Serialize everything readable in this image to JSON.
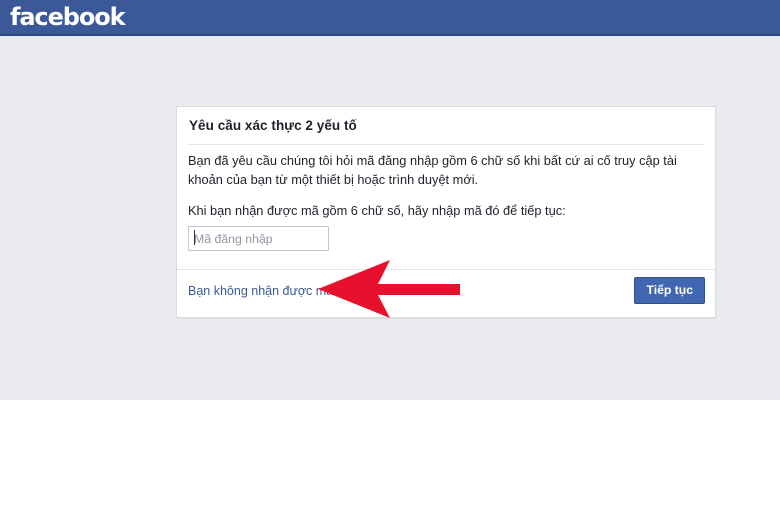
{
  "topbar": {
    "logo_text": "facebook",
    "background_color": "#3b5998"
  },
  "card": {
    "title": "Yêu cầu xác thực 2 yếu tố",
    "paragraphs": [
      "Bạn đã yêu cầu chúng tôi hỏi mã đăng nhập gồm 6 chữ số khi bất cứ ai cố truy cập tài khoản của bạn từ một thiết bị hoặc trình duyệt mới.",
      "Khi bạn nhận được mã gồm 6 chữ số, hãy nhập mã đó để tiếp tục:"
    ],
    "code_input": {
      "value": "",
      "placeholder": "Mã đăng nhập"
    },
    "footer": {
      "help_link": "Bạn không nhận được mã?",
      "submit_label": "Tiếp tục",
      "link_color": "#3b5998",
      "button_color": "#4267b2"
    }
  },
  "annotation": {
    "arrow_color": "#e8112d",
    "direction": "left"
  }
}
